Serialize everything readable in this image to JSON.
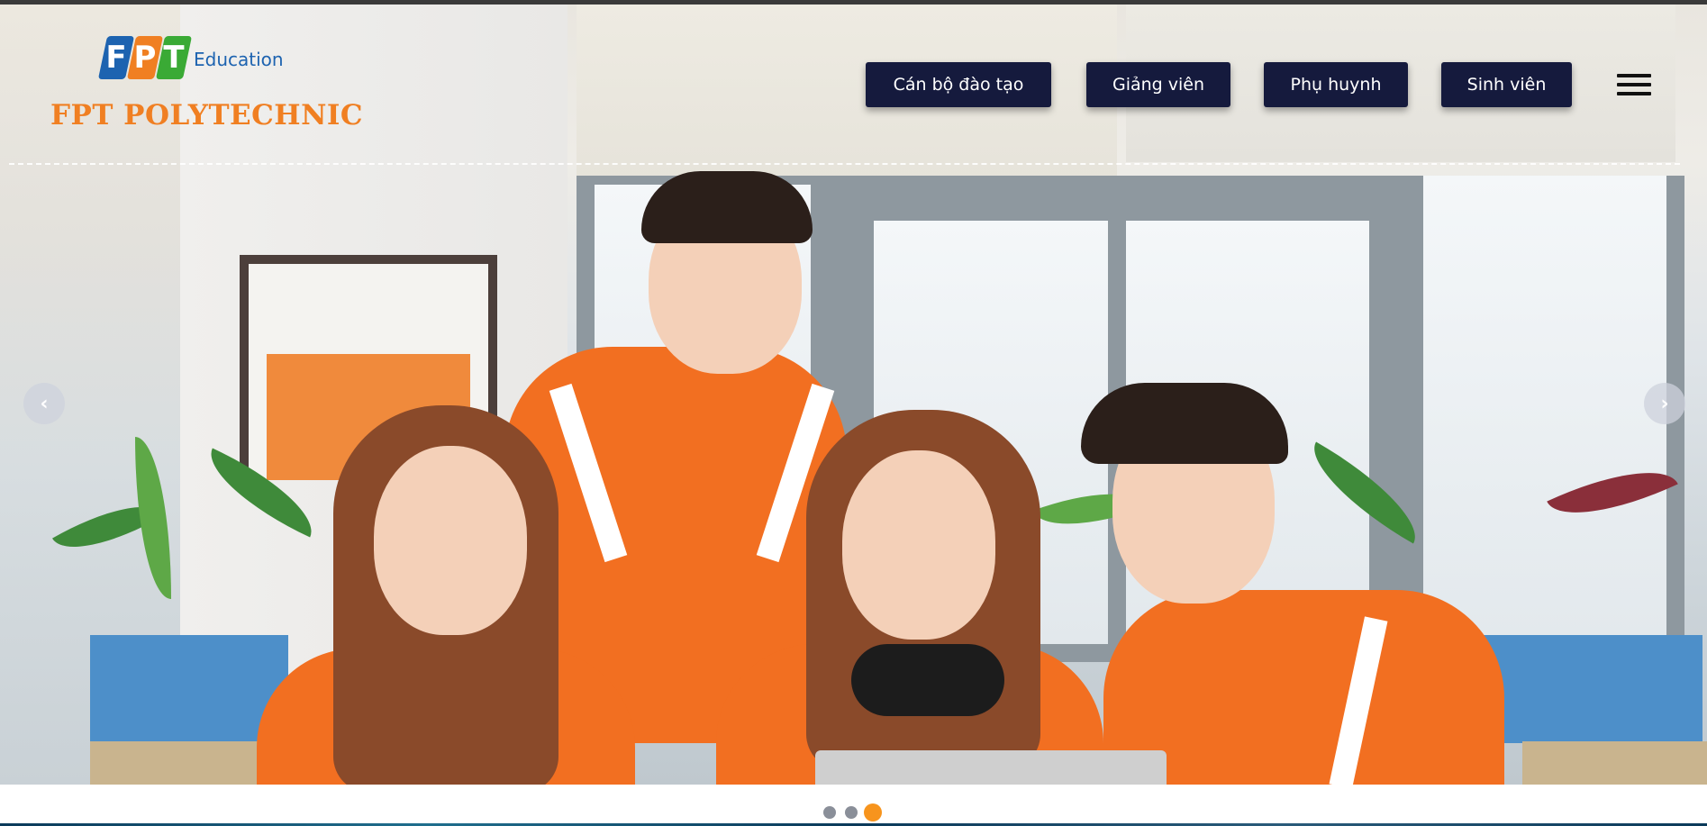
{
  "brand": {
    "fpt_letters": [
      "F",
      "P",
      "T"
    ],
    "fpt_colors": [
      "#1d63b0",
      "#f07f22",
      "#3aaa35"
    ],
    "education": "Education",
    "polytechnic": "FPT POLYTECHNIC",
    "accent_orange": "#f07f22"
  },
  "nav": {
    "buttons": [
      {
        "label": "Cán bộ đào tạo"
      },
      {
        "label": "Giảng viên"
      },
      {
        "label": "Phụ huynh"
      },
      {
        "label": "Sinh viên"
      }
    ],
    "button_color": "#151a3d",
    "menu_icon": "hamburger-menu-icon"
  },
  "carousel": {
    "prev_icon": "chevron-left-icon",
    "next_icon": "chevron-right-icon",
    "prev_glyph": "‹",
    "next_glyph": "›",
    "slide_count": 3,
    "active_index": 2,
    "active_dot_color": "#f7941d"
  }
}
